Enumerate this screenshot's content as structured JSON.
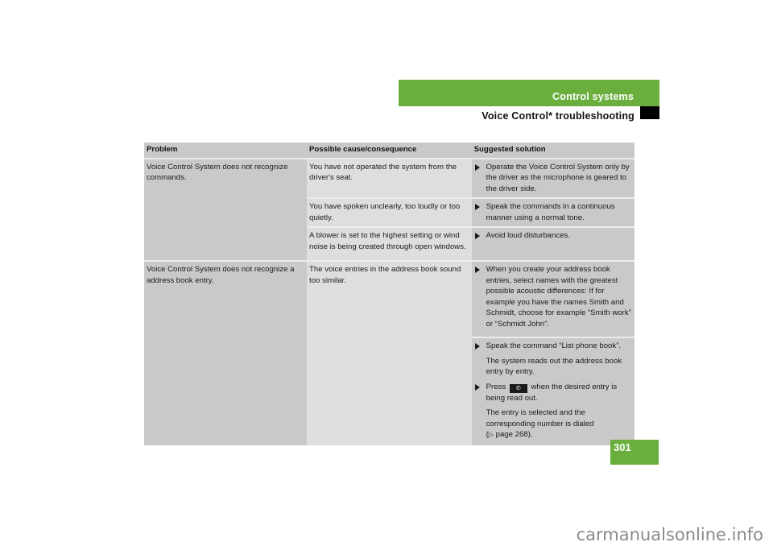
{
  "header": {
    "section_title": "Control systems",
    "subtitle": "Voice Control* troubleshooting",
    "accent_color": "#6aaf3d"
  },
  "table": {
    "columns": [
      "Problem",
      "Possible cause/consequence",
      "Suggested solution"
    ],
    "groups": [
      {
        "problem": "Voice Control System does not recognize commands.",
        "causes": [
          {
            "cause": "You have not operated the system from the driver's seat.",
            "solutions": [
              {
                "text": "Operate the Voice Control System only by the driver as the microphone is geared to the driver side."
              }
            ]
          },
          {
            "cause": "You have spoken unclearly, too loudly or too quietly.",
            "solutions": [
              {
                "text": "Speak the commands in a continuous manner using a normal tone."
              }
            ]
          },
          {
            "cause": "A blower is set to the highest setting or wind noise is being created through open windows.",
            "solutions": [
              {
                "text": "Avoid loud disturbances."
              }
            ]
          }
        ]
      },
      {
        "problem": "Voice Control System does not recognize a address book entry.",
        "causes": [
          {
            "cause": "The voice entries in the address book sound too similar.",
            "solutions_block1": [
              {
                "text": "When you create your address book entries, select names with the greatest possible acoustic differences: If for example you have the names Smith and Schmidt, choose for example “Smith work” or “Schmidt John”."
              }
            ],
            "solutions_block2": {
              "step1": "Speak the command “List phone book”.",
              "step1_note": "The system reads out the address book entry by entry.",
              "step2_prefix": "Press",
              "step2_icon": "phone-key-icon",
              "step2_suffix": "when the desired entry is being read out.",
              "step2_note_text": "The entry is selected and the corresponding number is dialed",
              "step2_note_ref_arrow": "▷",
              "step2_note_ref": "page 268",
              "step2_note_ref_open": "(",
              "step2_note_ref_close": ")."
            }
          }
        ]
      }
    ]
  },
  "footer": {
    "page_number": "301",
    "watermark": "carmanualsonline.info"
  }
}
